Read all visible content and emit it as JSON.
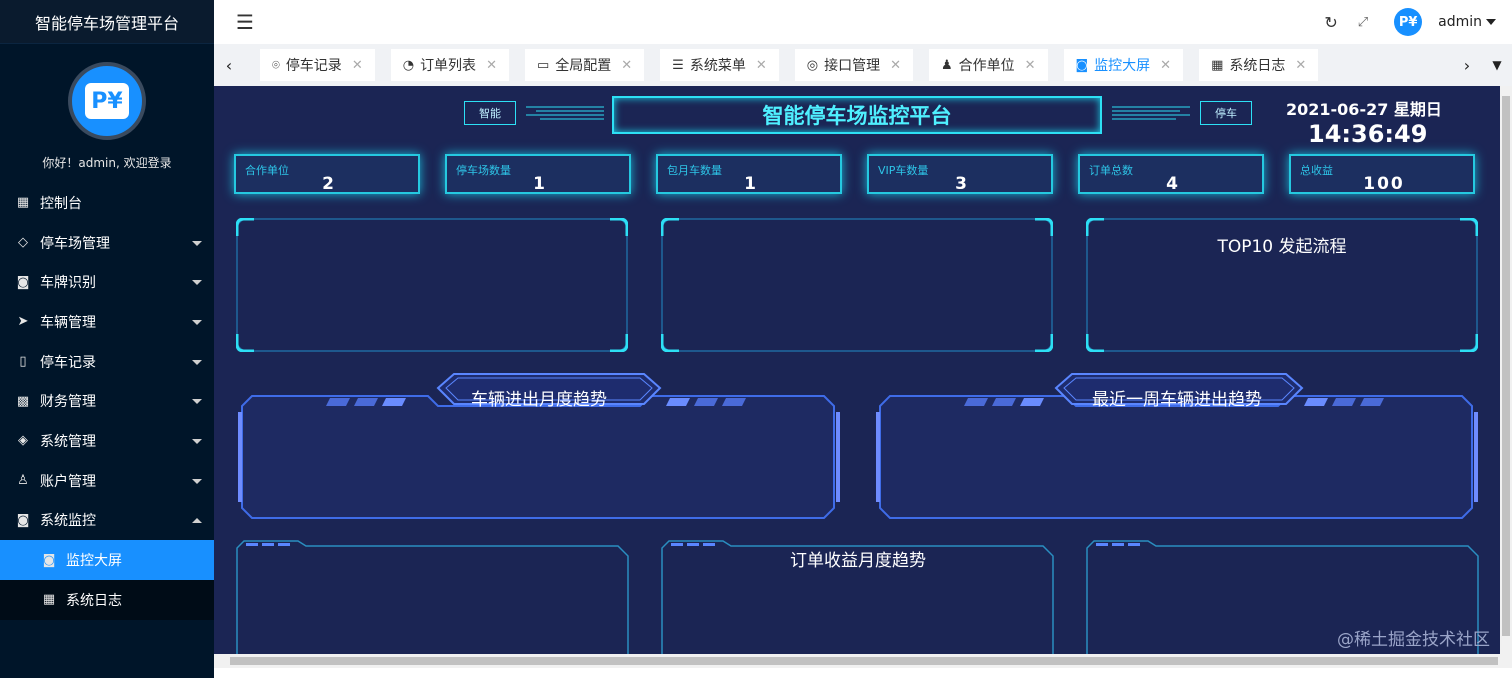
{
  "sidebar": {
    "title": "智能停车场管理平台",
    "greeting": "你好！admin, 欢迎登录",
    "items": [
      {
        "label": "控制台",
        "icon": "dashboard-icon",
        "expandable": false
      },
      {
        "label": "停车场管理",
        "icon": "diamond-icon",
        "expandable": true
      },
      {
        "label": "车牌识别",
        "icon": "camera-icon",
        "expandable": true
      },
      {
        "label": "车辆管理",
        "icon": "send-icon",
        "expandable": true
      },
      {
        "label": "停车记录",
        "icon": "note-icon",
        "expandable": true
      },
      {
        "label": "财务管理",
        "icon": "grid-icon",
        "expandable": true
      },
      {
        "label": "系统管理",
        "icon": "layers-icon",
        "expandable": true
      },
      {
        "label": "账户管理",
        "icon": "user-icon",
        "expandable": true
      },
      {
        "label": "系统监控",
        "icon": "camera-icon",
        "expandable": true,
        "expanded": true
      }
    ],
    "sub_items": [
      {
        "label": "监控大屏",
        "icon": "camera-icon",
        "active": true
      },
      {
        "label": "系统日志",
        "icon": "table-icon",
        "active": false
      }
    ]
  },
  "topbar": {
    "username": "admin"
  },
  "tabs": [
    {
      "label": "停车记录",
      "icon": "location-icon"
    },
    {
      "label": "订单列表",
      "icon": "palette-icon"
    },
    {
      "label": "全局配置",
      "icon": "car-icon"
    },
    {
      "label": "系统菜单",
      "icon": "list-icon"
    },
    {
      "label": "接口管理",
      "icon": "api-icon"
    },
    {
      "label": "合作单位",
      "icon": "person-icon"
    },
    {
      "label": "监控大屏",
      "icon": "camera-icon",
      "active": true
    },
    {
      "label": "系统日志",
      "icon": "table-icon"
    }
  ],
  "screen": {
    "title": "智能停车场监控平台",
    "tag_left": "智能",
    "tag_right": "停车",
    "date": "2021-06-27 星期日",
    "time": "14:36:49",
    "stats": [
      {
        "label": "合作单位",
        "value": "2"
      },
      {
        "label": "停车场数量",
        "value": "1"
      },
      {
        "label": "包月车数量",
        "value": "1"
      },
      {
        "label": "VIP车数量",
        "value": "3"
      },
      {
        "label": "订单总数",
        "value": "4"
      },
      {
        "label": "总收益",
        "value": "100"
      }
    ],
    "panel_top3_title": "TOP10 发起流程",
    "mid_left_title": "车辆进出月度趋势",
    "mid_right_title": "最近一周车辆进出趋势",
    "bot_mid_title": "订单收益月度趋势"
  },
  "watermark": "@稀土掘金技术社区",
  "colors": {
    "sidebar_bg": "#001529",
    "accent": "#1890ff",
    "screen_bg": "#1b2554",
    "cyan": "#2de0f5"
  }
}
